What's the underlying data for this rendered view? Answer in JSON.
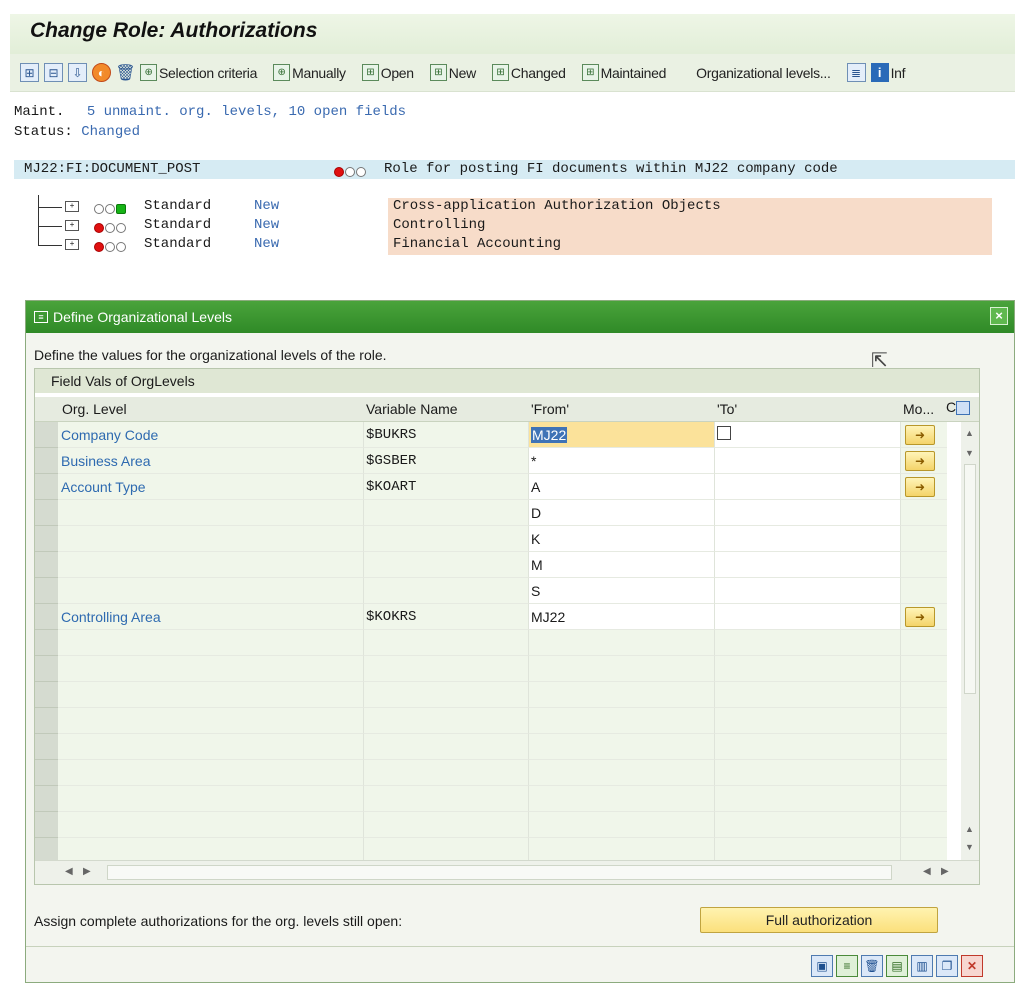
{
  "window": {
    "title": "Change Role: Authorizations"
  },
  "toolbar": {
    "selection_criteria": "Selection criteria",
    "manually": "Manually",
    "open": "Open",
    "new": "New",
    "changed": "Changed",
    "maintained": "Maintained",
    "org_levels": "Organizational levels...",
    "infos": "Inf"
  },
  "status": {
    "maint_label": "Maint.",
    "maint_value": "5 unmaint. org. levels, 10 open fields",
    "status_label": "Status:",
    "status_value": "Changed"
  },
  "role": {
    "name": "MJ22:FI:DOCUMENT_POST",
    "description": "Role for posting FI documents within MJ22 company code",
    "light": "red"
  },
  "tree": [
    {
      "type": "Standard",
      "state": "New",
      "desc": "Cross-application Authorization Objects",
      "light": "green"
    },
    {
      "type": "Standard",
      "state": "New",
      "desc": "Controlling",
      "light": "red"
    },
    {
      "type": "Standard",
      "state": "New",
      "desc": "Financial Accounting",
      "light": "red"
    }
  ],
  "dialog": {
    "title": "Define Organizational Levels",
    "description": "Define the values for the organizational levels of the role.",
    "grid_title": "Field Vals of OrgLevels",
    "columns": {
      "org_level": "Org. Level",
      "variable": "Variable Name",
      "from": "'From'",
      "to": "'To'",
      "more": "Mo...",
      "c": "C"
    },
    "rows": [
      {
        "org_level": "Company Code",
        "variable": "$BUKRS",
        "from": "MJ22",
        "to": ""
      },
      {
        "org_level": "Business Area",
        "variable": "$GSBER",
        "from": "*",
        "to": ""
      },
      {
        "org_level": "Account Type",
        "variable": "$KOART",
        "from": "A",
        "to": ""
      },
      {
        "org_level": "",
        "variable": "",
        "from": "D",
        "to": ""
      },
      {
        "org_level": "",
        "variable": "",
        "from": "K",
        "to": ""
      },
      {
        "org_level": "",
        "variable": "",
        "from": "M",
        "to": ""
      },
      {
        "org_level": "",
        "variable": "",
        "from": "S",
        "to": ""
      },
      {
        "org_level": "Controlling Area",
        "variable": "$KOKRS",
        "from": "MJ22",
        "to": ""
      }
    ],
    "assign_text": "Assign complete authorizations for the org. levels still open:",
    "full_auth_button": "Full authorization"
  },
  "icons": {
    "close": "close-icon",
    "more_values": "arrow-right-icon",
    "footer": [
      "save-icon",
      "transfer-icon",
      "delete-icon",
      "select-icon",
      "deselect-icon",
      "copy-icon",
      "cancel-icon"
    ]
  },
  "colors": {
    "dialog_header": "#3a9a2f",
    "button_yellow": "#fbe07c",
    "link_blue": "#2e6ab0",
    "row_salmon": "#f7dcc9",
    "role_row": "#d6ebf3"
  }
}
